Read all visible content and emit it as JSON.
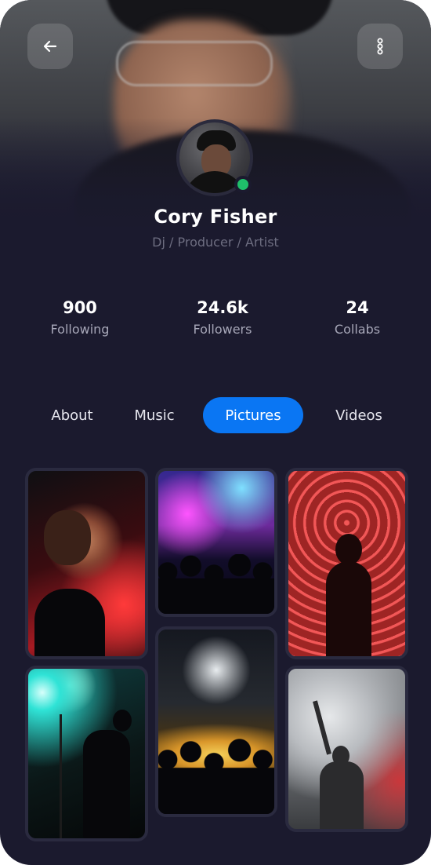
{
  "header": {
    "back_icon": "arrow-left-icon",
    "menu_icon": "more-vertical-icon"
  },
  "profile": {
    "name": "Cory Fisher",
    "role": "Dj / Producer / Artist",
    "online": true,
    "online_color": "#1fbf6a"
  },
  "stats": [
    {
      "value": "900",
      "label": "Following"
    },
    {
      "value": "24.6k",
      "label": "Followers"
    },
    {
      "value": "24",
      "label": "Collabs"
    }
  ],
  "tabs": [
    {
      "label": "About",
      "active": false
    },
    {
      "label": "Music",
      "active": false
    },
    {
      "label": "Pictures",
      "active": true
    },
    {
      "label": "Videos",
      "active": false
    }
  ],
  "gallery": {
    "photos": [
      {
        "subject": "singer with guitar at microphone, red light"
      },
      {
        "subject": "concert crowd under purple stage lights"
      },
      {
        "subject": "woman in front of red neon artwork"
      },
      {
        "subject": "guitarist silhouette under teal spotlight"
      },
      {
        "subject": "crowd with raised hands under yellow lights"
      },
      {
        "subject": "performer raising arm in stage smoke"
      }
    ]
  },
  "colors": {
    "background": "#1b1a2e",
    "accent": "#0a76f3",
    "text_primary": "#ffffff",
    "text_secondary": "#6d6d80",
    "tile_border": "#2a2a3f"
  }
}
